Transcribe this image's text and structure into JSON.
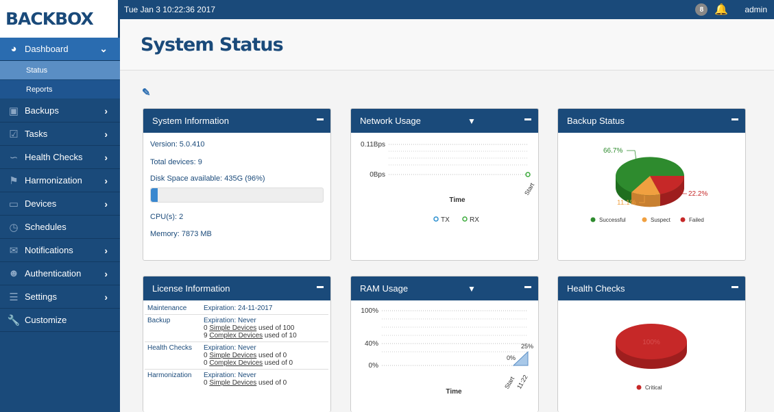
{
  "logo": "BACKBOX",
  "topbar": {
    "datetime": "Tue Jan 3 10:22:36 2017",
    "notification_count": "8",
    "user": "admin"
  },
  "sidebar": {
    "items": [
      {
        "label": "Dashboard",
        "icon": "dashboard-icon",
        "active": true
      },
      {
        "label": "Backups",
        "icon": "backups-icon"
      },
      {
        "label": "Tasks",
        "icon": "tasks-icon"
      },
      {
        "label": "Health Checks",
        "icon": "health-checks-icon"
      },
      {
        "label": "Harmonization",
        "icon": "harmonization-icon"
      },
      {
        "label": "Devices",
        "icon": "devices-icon"
      },
      {
        "label": "Schedules",
        "icon": "schedules-icon"
      },
      {
        "label": "Notifications",
        "icon": "notifications-icon"
      },
      {
        "label": "Authentication",
        "icon": "authentication-icon"
      },
      {
        "label": "Settings",
        "icon": "settings-icon"
      },
      {
        "label": "Customize",
        "icon": "customize-icon"
      }
    ],
    "sub_items": [
      {
        "label": "Status",
        "selected": true
      },
      {
        "label": "Reports"
      }
    ]
  },
  "page": {
    "title": "System Status"
  },
  "system_info": {
    "title": "System Information",
    "version": "Version: 5.0.410",
    "total_devices": "Total devices: 9",
    "disk": "Disk Space available: 435G (96%)",
    "disk_used_fraction": 0.04,
    "cpus": "CPU(s): 2",
    "memory": "Memory: 7873 MB"
  },
  "network": {
    "title": "Network Usage",
    "y_top": "0.11Bps",
    "y_zero": "0Bps",
    "x_tick": "Start",
    "xlabel": "Time",
    "legend": [
      "TX",
      "RX"
    ],
    "tx_color": "#2a8fcf",
    "rx_color": "#3cab3c"
  },
  "backup_status": {
    "title": "Backup Status",
    "labels": [
      "66.7%",
      "11.1%",
      "22.2%"
    ],
    "legend": [
      "Successful",
      "Suspect",
      "Failed"
    ],
    "colors": {
      "successful": "#2e8b2e",
      "suspect": "#f0a040",
      "failed": "#c62828"
    }
  },
  "license": {
    "title": "License Information",
    "rows": [
      {
        "name": "Maintenance",
        "expiration": "Expiration: 24-11-2017",
        "lines": []
      },
      {
        "name": "Backup",
        "expiration": "Expiration: Never",
        "lines": [
          {
            "count": "0",
            "link": "Simple Devices",
            "rest": " used of 100"
          },
          {
            "count": "9",
            "link": "Complex Devices",
            "rest": " used of 10"
          }
        ]
      },
      {
        "name": "Health Checks",
        "expiration": "Expiration: Never",
        "lines": [
          {
            "count": "0",
            "link": "Simple Devices",
            "rest": " used of 0"
          },
          {
            "count": "0",
            "link": "Complex Devices",
            "rest": " used of 0"
          }
        ]
      },
      {
        "name": "Harmonization",
        "expiration": "Expiration: Never",
        "lines": [
          {
            "count": "0",
            "link": "Simple Devices",
            "rest": " used of 0"
          }
        ]
      }
    ]
  },
  "ram": {
    "title": "RAM Usage",
    "y_ticks": [
      "100%",
      "40%",
      "0%"
    ],
    "labels": [
      "25%",
      "0%"
    ],
    "x_ticks": [
      "Start",
      "11:22"
    ],
    "xlabel": "Time"
  },
  "health_checks": {
    "title": "Health Checks",
    "center_label": "100%",
    "legend": [
      "Critical"
    ],
    "color": "#c62828"
  }
}
